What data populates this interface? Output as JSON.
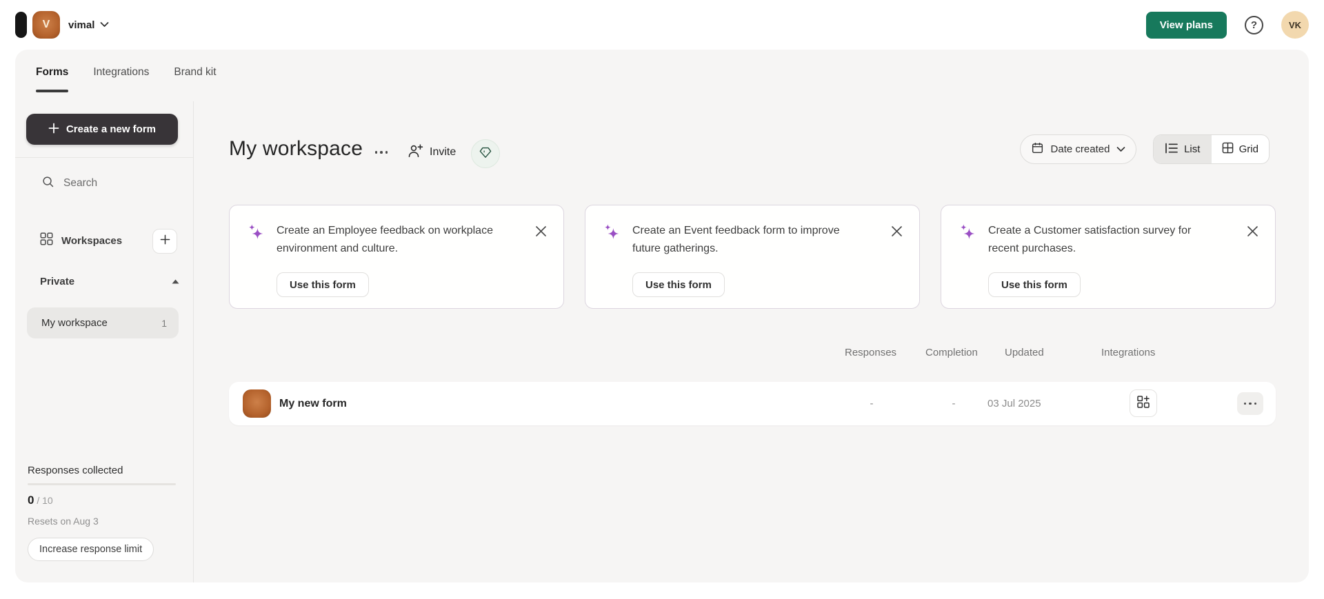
{
  "topbar": {
    "workspace_avatar_letter": "V",
    "workspace_name": "vimal",
    "view_plans_label": "View plans",
    "help_glyph": "?",
    "user_initials": "VK"
  },
  "tabs": [
    {
      "label": "Forms",
      "active": true
    },
    {
      "label": "Integrations",
      "active": false
    },
    {
      "label": "Brand kit",
      "active": false
    }
  ],
  "sidebar": {
    "create_button_label": "Create a new form",
    "search_label": "Search",
    "workspaces_label": "Workspaces",
    "private_label": "Private",
    "items": [
      {
        "label": "My workspace",
        "count": "1"
      }
    ],
    "usage": {
      "title": "Responses collected",
      "used": "0",
      "separator": "/",
      "limit": "10",
      "resets": "Resets on Aug 3",
      "increase_button_label": "Increase response limit"
    }
  },
  "main": {
    "title": "My workspace",
    "invite_label": "Invite",
    "sort_label": "Date created",
    "view_toggle": {
      "list_label": "List",
      "grid_label": "Grid",
      "selected": "List"
    },
    "suggestions": [
      {
        "text": "Create an Employee feedback on workplace environment and culture.",
        "button_label": "Use this form"
      },
      {
        "text": "Create an Event feedback form to improve future gatherings.",
        "button_label": "Use this form"
      },
      {
        "text": "Create a Customer satisfaction survey for recent purchases.",
        "button_label": "Use this form"
      }
    ],
    "table": {
      "headers": [
        "Responses",
        "Completion",
        "Updated",
        "Integrations"
      ],
      "rows": [
        {
          "name": "My new form",
          "responses": "-",
          "completion": "-",
          "updated": "03 Jul 2025"
        }
      ]
    }
  },
  "icons": {
    "logo": "black-pill-logo",
    "chevron_down": "chevron-down",
    "search": "magnifier",
    "plus": "plus",
    "workspaces": "2x2-grid",
    "caret_up": "filled-triangle-up",
    "ellipsis": "three-dots",
    "invite": "person-plus",
    "gem": "diamond-gem",
    "calendar": "calendar",
    "list_view": "list-lines",
    "grid_view": "window-grid",
    "sparkles": "ai-sparkles",
    "close": "x-cross",
    "integrations_add": "grid-plus",
    "help": "question-mark-circle"
  },
  "colors": {
    "accent_green": "#17795c",
    "dark_button": "#383438",
    "sparkle_purple": "#9a4fc4",
    "orange_avatar": "#b4622c",
    "user_avatar_tan": "#f2d8ae",
    "shell_background": "#f6f5f4",
    "card_border": "#dcd5df",
    "gem_badge_bg": "#edf3ee"
  }
}
